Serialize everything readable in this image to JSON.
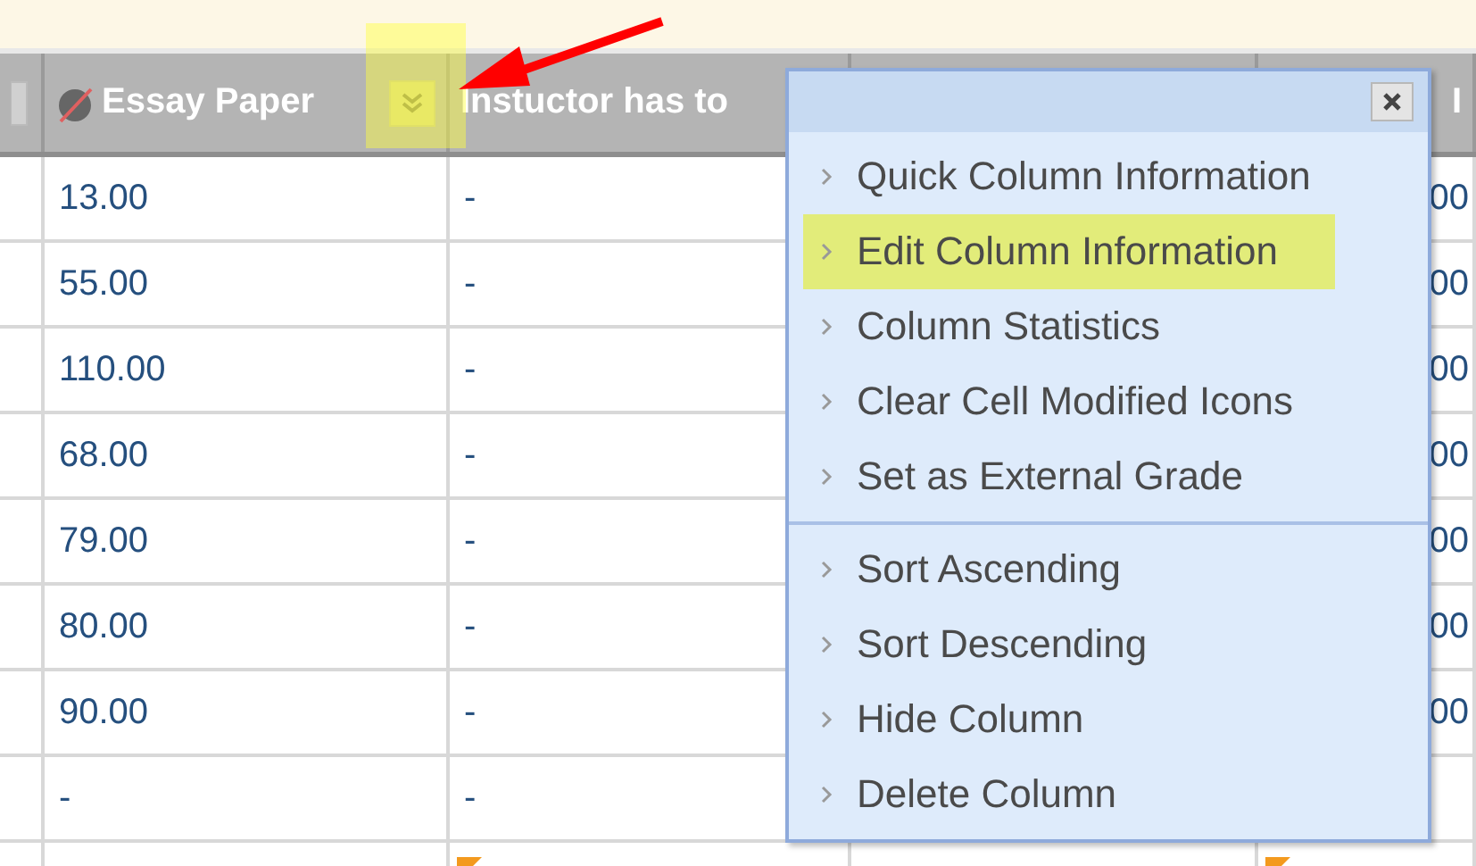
{
  "table": {
    "columns": [
      {
        "label": "Essay Paper",
        "hidden_icon": true,
        "menu_button": true
      },
      {
        "label": "Instuctor has to",
        "hidden_icon": false,
        "menu_button": false
      },
      {
        "label": "I",
        "hidden_icon": false,
        "menu_button": false
      }
    ],
    "rows": [
      {
        "cells": [
          "13.00",
          "-",
          "00"
        ]
      },
      {
        "cells": [
          "55.00",
          "-",
          "00"
        ]
      },
      {
        "cells": [
          "110.00",
          "-",
          "00"
        ]
      },
      {
        "cells": [
          "68.00",
          "-",
          "00"
        ]
      },
      {
        "cells": [
          "79.00",
          "-",
          "00"
        ]
      },
      {
        "cells": [
          "80.00",
          "-",
          "00"
        ]
      },
      {
        "cells": [
          "90.00",
          "-",
          "00"
        ]
      },
      {
        "cells": [
          "-",
          "-"
        ]
      },
      {
        "modified": [
          false,
          true,
          true
        ]
      }
    ]
  },
  "menu": {
    "groups": [
      {
        "items": [
          {
            "label": "Quick Column Information",
            "selected": false
          },
          {
            "label": "Edit Column Information",
            "selected": true
          },
          {
            "label": "Column Statistics",
            "selected": false
          },
          {
            "label": "Clear Cell Modified Icons",
            "selected": false
          },
          {
            "label": "Set as External Grade",
            "selected": false
          }
        ]
      },
      {
        "items": [
          {
            "label": "Sort Ascending",
            "selected": false
          },
          {
            "label": "Sort Descending",
            "selected": false
          },
          {
            "label": "Hide Column",
            "selected": false
          },
          {
            "label": "Delete Column",
            "selected": false
          }
        ]
      }
    ]
  }
}
